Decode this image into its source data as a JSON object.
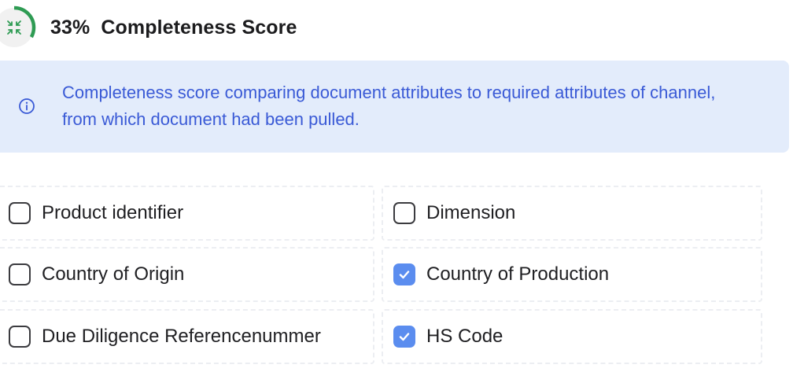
{
  "header": {
    "score": "33%",
    "title": "Completeness Score",
    "progress": 0.33,
    "ring_color": "#2e9b53",
    "ring_track_color": "#eeeeee",
    "icon": "compress-arrows-icon"
  },
  "info": {
    "icon": "info-circle-icon",
    "text": "Completeness score comparing document attributes to required attributes of channel, from which document had been pulled."
  },
  "attributes": [
    {
      "label": "Product identifier",
      "checked": false
    },
    {
      "label": "Dimension",
      "checked": false
    },
    {
      "label": "Country of Origin",
      "checked": false
    },
    {
      "label": "Country of Production",
      "checked": true
    },
    {
      "label": "Due Diligence Referencenummer",
      "checked": false
    },
    {
      "label": "HS Code",
      "checked": true
    }
  ],
  "colors": {
    "banner_bg": "#e3ecfb",
    "banner_text": "#3a5ad6",
    "checkbox_checked": "#5b8def"
  }
}
